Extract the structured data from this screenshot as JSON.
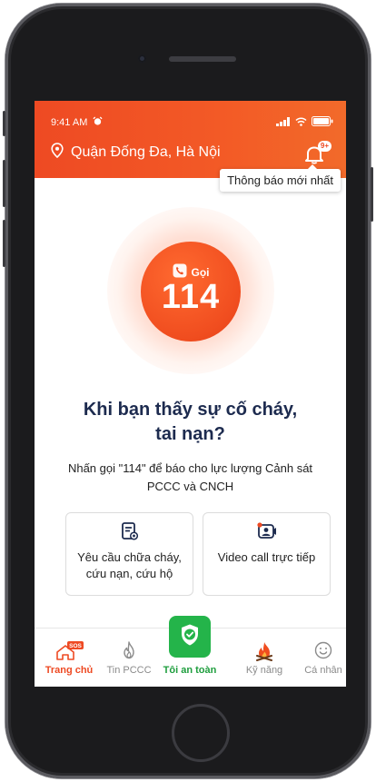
{
  "status_bar": {
    "time": "9:41 AM"
  },
  "header": {
    "location": "Quận Đống Đa, Hà Nội",
    "notification_badge": "9+",
    "tooltip": "Thông báo mới nhất"
  },
  "call": {
    "label": "Gọi",
    "number": "114"
  },
  "main": {
    "question": "Khi bạn thấy sự cố cháy, tai nạn?",
    "description": "Nhấn gọi \"114\" để báo cho lực lượng Cảnh sát PCCC và CNCH",
    "cards": [
      {
        "label": "Yêu cầu chữa cháy, cứu nạn, cứu hộ",
        "icon": "request-form-icon"
      },
      {
        "label": "Video call trực tiếp",
        "icon": "video-call-icon"
      }
    ]
  },
  "nav": {
    "items": [
      {
        "label": "Trang chủ",
        "icon": "home-sos-icon",
        "badge": "SOS",
        "active": true
      },
      {
        "label": "Tin PCCC",
        "icon": "fire-icon"
      },
      {
        "label": "Tôi an toàn",
        "icon": "shield-check-icon"
      },
      {
        "label": "Kỹ năng",
        "icon": "fire-skill-icon"
      },
      {
        "label": "Cá nhân",
        "icon": "smile-icon"
      }
    ]
  },
  "colors": {
    "accent": "#ee4a23",
    "safe": "#24b44a",
    "title": "#1d2b4f"
  }
}
